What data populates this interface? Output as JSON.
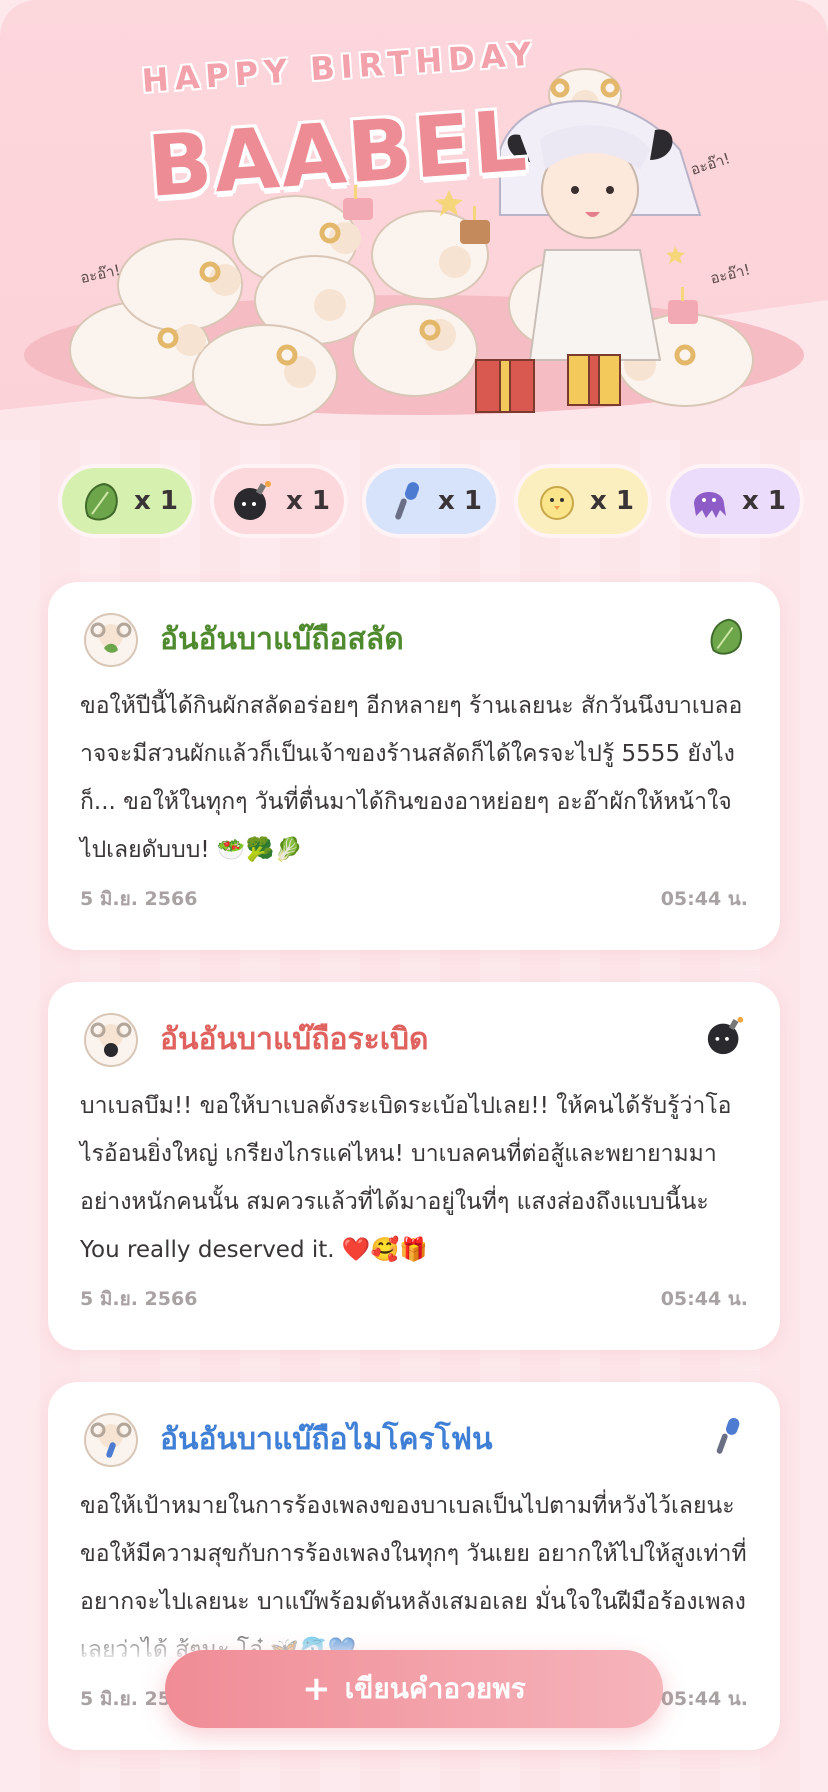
{
  "hero": {
    "subtitle": "HAPPY BIRTHDAY",
    "title": "BAABEL",
    "exclaims": [
      "อะอ๊า!",
      "อะอ๊า!",
      "อะอ๊า!"
    ]
  },
  "tallies": [
    {
      "icon": "lettuce-icon",
      "count": "x 1",
      "bg": "#d6f0b0"
    },
    {
      "icon": "bomb-icon",
      "count": "x 1",
      "bg": "#fcd7dc"
    },
    {
      "icon": "microphone-icon",
      "count": "x 1",
      "bg": "#d6e3fb"
    },
    {
      "icon": "chick-icon",
      "count": "x 1",
      "bg": "#fbefc0"
    },
    {
      "icon": "octopus-icon",
      "count": "x 1",
      "bg": "#ecdcfb"
    }
  ],
  "cards": [
    {
      "title": "อันอันบาแบ๊ถือสลัด",
      "title_color": "#4f8a2f",
      "icon": "lettuce-icon",
      "message": "ขอให้ปีนี้ได้กินผักสลัดอร่อยๆ อีกหลายๆ ร้านเลยนะ สักวันนึงบาเบลอาจจะมีสวนผักแล้วก็เป็นเจ้าของร้านสลัดก็ได้ใครจะไปรู้ 5555 ยังไงก็... ขอให้ในทุกๆ วันที่ตื่นมาได้กินของอาหย่อยๆ อะอ๊าผักให้หน้าใจไปเลยดับบบ! 🥗🥦🥬",
      "date": "5 มิ.ย. 2566",
      "time": "05:44 น."
    },
    {
      "title": "อันอันบาแบ๊ถือระเบิด",
      "title_color": "#e0625e",
      "icon": "bomb-icon",
      "message": "บาเบลบึม!! ขอให้บาเบลดังระเบิดระเบ้อไปเลย!! ให้คนได้รับรู้ว่าโอไรอ้อนยิ่งใหญ่ เกรียงไกรแค่ไหน! บาเบลคนที่ต่อสู้และพยายามมาอย่างหนักคนนั้น สมควรแล้วที่ได้มาอยู่ในที่ๆ แสงส่องถึงแบบนี้นะ You really deserved it. ❤️🥰🎁",
      "date": "5 มิ.ย. 2566",
      "time": "05:44 น."
    },
    {
      "title": "อันอันบาแบ๊ถือไมโครโฟน",
      "title_color": "#3f7fd6",
      "icon": "microphone-icon",
      "message": "ขอให้เป้าหมายในการร้องเพลงของบาเบลเป็นไปตามที่หวังไว้เลยนะ ขอให้มีความสุขกับการร้องเพลงในทุกๆ วันเยย อยากให้ไปให้สูงเท่าที่อยากจะไปเลยนะ บาแบ๊พร้อมดันหลังเสมอเลย มั่นใจในฝีมือร้องเพลงเลยว่าได้ สู้ๆนะ โอ๋ 🦋🐬💙",
      "date": "5 มิ.ย. 256",
      "time": "05:44 น."
    }
  ],
  "fab": {
    "plus": "+",
    "label": "เขียนคำอวยพร"
  }
}
